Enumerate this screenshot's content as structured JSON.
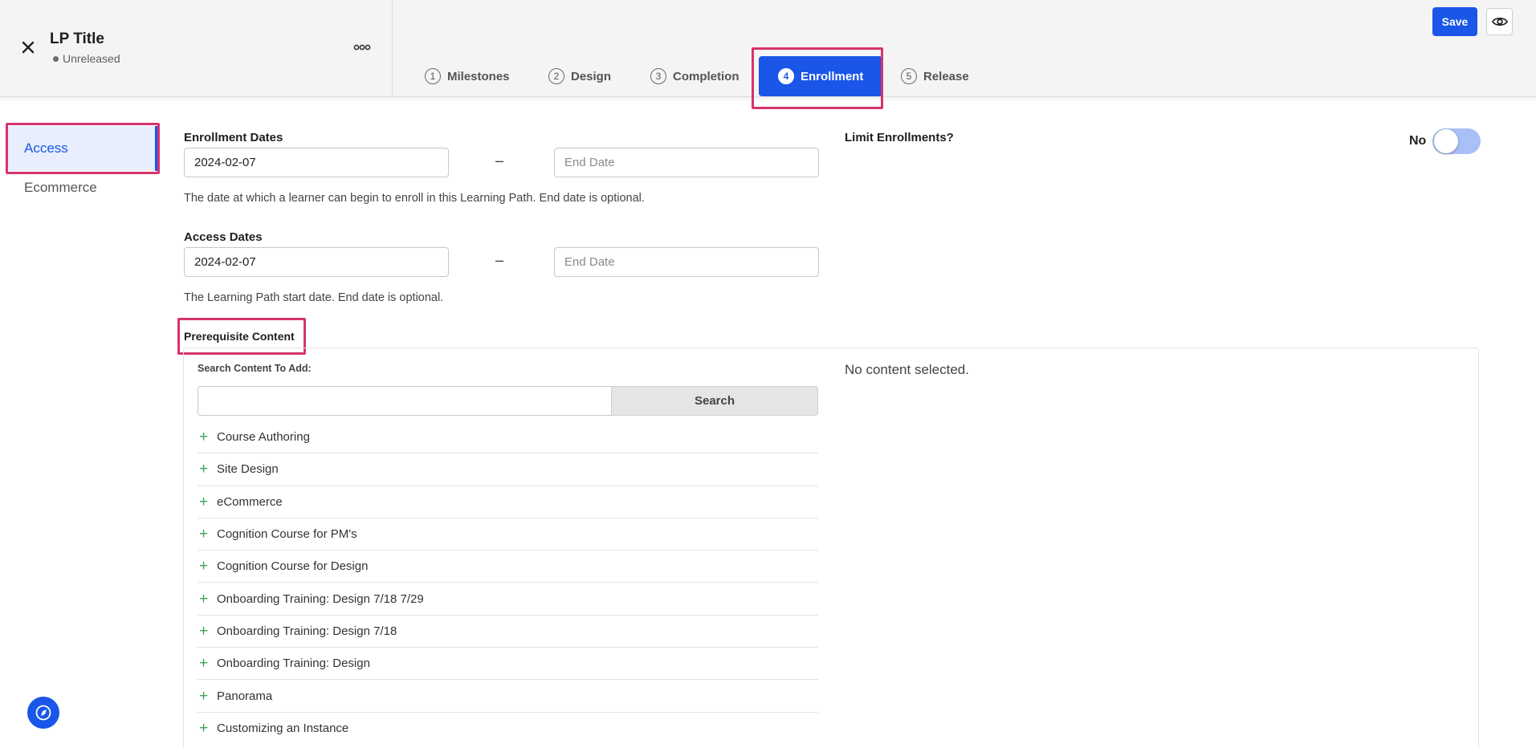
{
  "header": {
    "title": "LP Title",
    "status": "Unreleased",
    "save_label": "Save",
    "tabs": [
      {
        "num": "1",
        "label": "Milestones"
      },
      {
        "num": "2",
        "label": "Design"
      },
      {
        "num": "3",
        "label": "Completion"
      },
      {
        "num": "4",
        "label": "Enrollment"
      },
      {
        "num": "5",
        "label": "Release"
      }
    ],
    "active_tab": "Enrollment"
  },
  "sidebar": {
    "items": [
      {
        "label": "Access",
        "active": true
      },
      {
        "label": "Ecommerce",
        "active": false
      }
    ]
  },
  "enrollment": {
    "label": "Enrollment Dates",
    "start_value": "2024-02-07",
    "end_placeholder": "End Date",
    "separator": "–",
    "help": "The date at which a learner can begin to enroll in this Learning Path. End date is optional."
  },
  "access": {
    "label": "Access Dates",
    "start_value": "2024-02-07",
    "end_placeholder": "End Date",
    "separator": "–",
    "help": "The Learning Path start date. End date is optional."
  },
  "limit": {
    "label": "Limit Enrollments?",
    "toggle_text": "No",
    "enabled": false
  },
  "prerequisite": {
    "label": "Prerequisite Content",
    "search_label": "Search Content To Add:",
    "search_value": "",
    "search_button": "Search",
    "empty_text": "No content selected.",
    "items": [
      "Course Authoring",
      "Site Design",
      "eCommerce",
      "Cognition Course for PM's",
      "Cognition Course for Design",
      "Onboarding Training: Design 7/18 7/29",
      "Onboarding Training: Design 7/18",
      "Onboarding Training: Design",
      "Panorama",
      "Customizing an Instance"
    ]
  },
  "colors": {
    "accent": "#1a56e8",
    "highlight": "#d6336c",
    "add_icon": "#3aa35b"
  },
  "icons": {
    "close": "close-icon",
    "more": "more-options-icon",
    "preview": "eye-icon",
    "add": "plus-icon",
    "help_widget": "compass-icon"
  }
}
